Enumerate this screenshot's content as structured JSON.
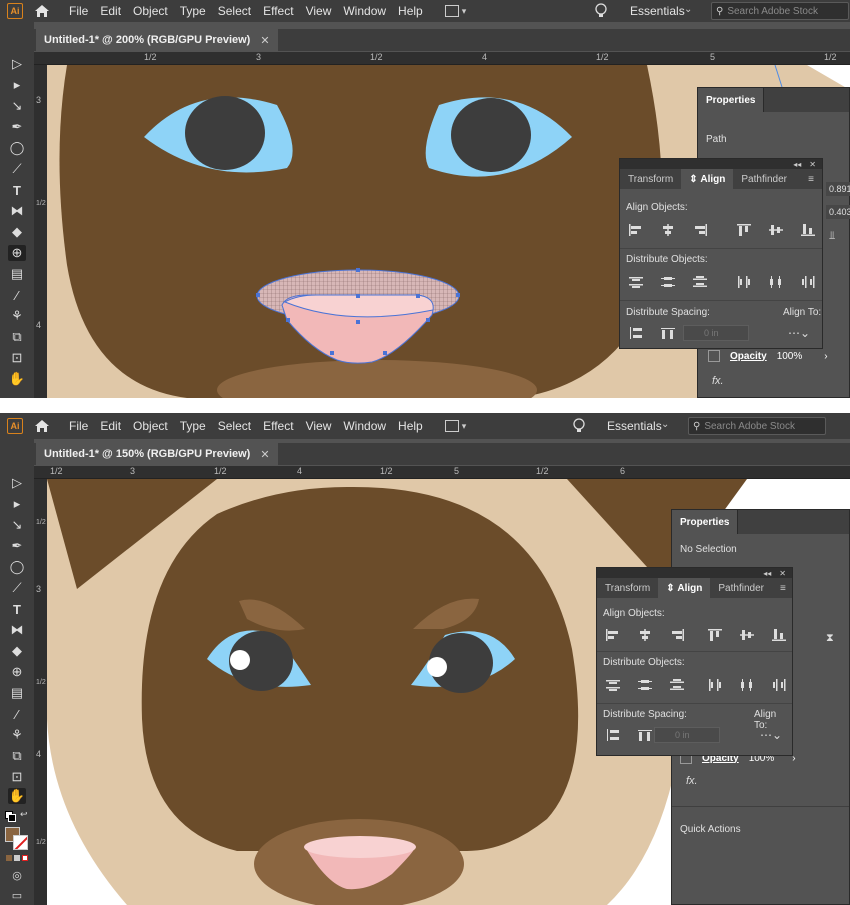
{
  "app": {
    "logo": "Ai"
  },
  "menu": [
    "File",
    "Edit",
    "Object",
    "Type",
    "Select",
    "Effect",
    "View",
    "Window",
    "Help"
  ],
  "workspace": "Essentials",
  "search_placeholder": "Search Adobe Stock",
  "screens": [
    {
      "doc_tab": "Untitled-1* @ 200% (RGB/GPU Preview)",
      "ruler_h": [
        "1/2",
        "3",
        "1/2",
        "4",
        "1/2",
        "5",
        "1/2"
      ],
      "ruler_v": [
        "3",
        "1/2",
        "4"
      ],
      "properties": {
        "tab": "Properties",
        "selection": "Path",
        "values": [
          "0.891",
          "0.403"
        ]
      },
      "opacity": {
        "label": "Opacity",
        "value": "100%"
      }
    },
    {
      "doc_tab": "Untitled-1* @ 150% (RGB/GPU Preview)",
      "ruler_h": [
        "1/2",
        "3",
        "1/2",
        "4",
        "1/2",
        "5",
        "1/2",
        "6"
      ],
      "ruler_v": [
        "1/2",
        "3",
        "1/2",
        "4",
        "1/2"
      ],
      "properties": {
        "tab": "Properties",
        "selection": "No Selection",
        "quick_actions": "Quick Actions"
      },
      "opacity": {
        "label": "Opacity",
        "value": "100%"
      }
    }
  ],
  "align_panel": {
    "tabs": [
      "Transform",
      "Align",
      "Pathfinder"
    ],
    "active_tab": "Align",
    "align_objects": "Align Objects:",
    "distribute_objects": "Distribute Objects:",
    "distribute_spacing": "Distribute Spacing:",
    "align_to": "Align To:",
    "spacing_value": "0 in"
  },
  "fx_label": "fx.",
  "colors": {
    "fur_dark": "#6b4c2a",
    "fur_light": "#e0c8a8",
    "eye_blue": "#8ed3f7",
    "pupil": "#3d3d3d",
    "nose_pink": "#f2b8b8",
    "muzzle": "#8a6540",
    "accent_orange": "#d9821c"
  }
}
